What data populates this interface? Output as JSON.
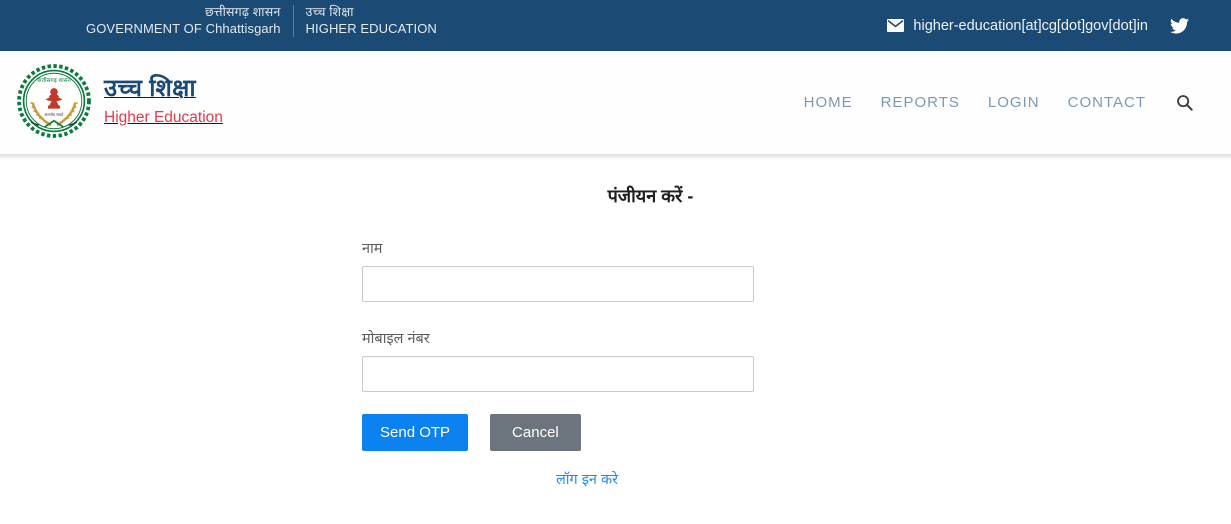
{
  "topbar": {
    "gov_hi": "छत्तीसगढ़ शासन",
    "gov_en": "GOVERNMENT OF Chhattisgarh",
    "dept_hi": "उच्च शिक्षा",
    "dept_en": "HIGHER EDUCATION",
    "email": "higher-education[at]cg[dot]gov[dot]in",
    "mail_icon": "envelope-icon",
    "twitter_icon": "twitter-icon",
    "bg_color": "#1b4a74"
  },
  "header": {
    "emblem_icon": "chhattisgarh-government-emblem",
    "brand_hi": "उच्च शिक्षा",
    "brand_en": "Higher Education",
    "brand_hi_color": "#1b4a74",
    "brand_en_color": "#e8384a",
    "nav": [
      {
        "label": "HOME",
        "name": "nav-home"
      },
      {
        "label": "REPORTS",
        "name": "nav-reports"
      },
      {
        "label": "LOGIN",
        "name": "nav-login"
      },
      {
        "label": "CONTACT",
        "name": "nav-contact"
      }
    ],
    "search_icon": "search-icon",
    "nav_color": "#7e98b4"
  },
  "form": {
    "title": "पंजीयन करें -",
    "name_label": "नाम",
    "name_value": "",
    "name_placeholder": "",
    "mobile_label": "मोबाइल नंबर",
    "mobile_value": "",
    "mobile_placeholder": "",
    "submit_label": "Send OTP",
    "cancel_label": "Cancel",
    "login_link_label": "लॉग इन करे",
    "submit_color": "#0b82f0",
    "cancel_color": "#6c757d",
    "link_color": "#1a8cff"
  }
}
